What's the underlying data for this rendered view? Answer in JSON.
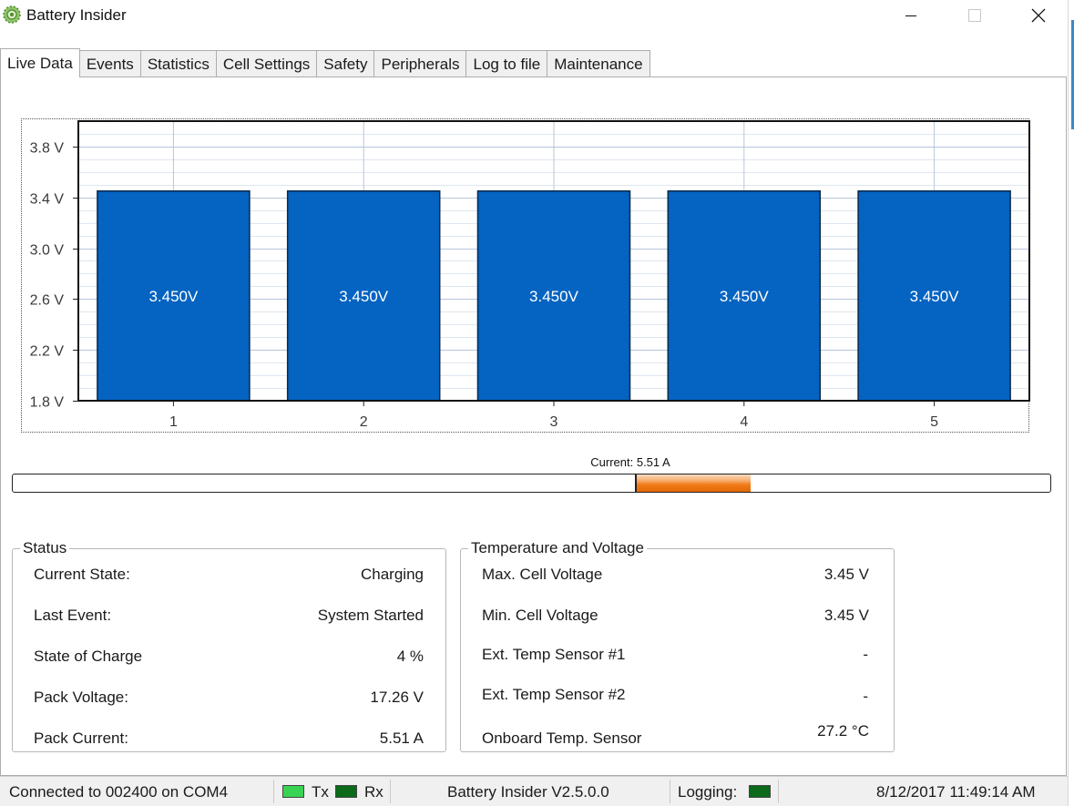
{
  "window": {
    "title": "Battery Insider",
    "icon": "gear-flower-icon",
    "controls": [
      "minimize",
      "maximize",
      "close"
    ]
  },
  "tabs": [
    {
      "label": "Live Data",
      "active": true
    },
    {
      "label": "Events",
      "active": false
    },
    {
      "label": "Statistics",
      "active": false
    },
    {
      "label": "Cell Settings",
      "active": false
    },
    {
      "label": "Safety",
      "active": false
    },
    {
      "label": "Peripherals",
      "active": false
    },
    {
      "label": "Log to file",
      "active": false
    },
    {
      "label": "Maintenance",
      "active": false
    }
  ],
  "chart_data": {
    "type": "bar",
    "categories": [
      "1",
      "2",
      "3",
      "4",
      "5"
    ],
    "values": [
      3.45,
      3.45,
      3.45,
      3.45,
      3.45
    ],
    "bar_labels": [
      "3.450V",
      "3.450V",
      "3.450V",
      "3.450V",
      "3.450V"
    ],
    "ylim": [
      1.8,
      4.0
    ],
    "yticks": [
      1.8,
      2.2,
      2.6,
      3.0,
      3.4,
      3.8
    ],
    "ytick_labels": [
      "1.8 V",
      "2.2 V",
      "2.6 V",
      "3.0 V",
      "3.4 V",
      "3.8 V"
    ],
    "grid": true,
    "bar_color": "#0563c1",
    "title": "",
    "xlabel": "",
    "ylabel": ""
  },
  "current": {
    "label": "Current: 5.51 A",
    "value_a": 5.51,
    "fill_fraction": 0.11,
    "fill_color": "#f07a17"
  },
  "status": {
    "title": "Status",
    "rows": [
      {
        "label": "Current State:",
        "value": "Charging"
      },
      {
        "label": "Last Event:",
        "value": "System Started"
      },
      {
        "label": "State of Charge",
        "value": "4 %"
      },
      {
        "label": "Pack Voltage:",
        "value": "17.26 V"
      },
      {
        "label": "Pack Current:",
        "value": "5.51 A"
      }
    ]
  },
  "temp_voltage": {
    "title": "Temperature and Voltage",
    "rows": [
      {
        "label": "Max. Cell Voltage",
        "value": "3.45 V"
      },
      {
        "label": "Min. Cell Voltage",
        "value": "3.45 V"
      },
      {
        "label": "Ext. Temp Sensor #1",
        "value": "-"
      },
      {
        "label": "Ext. Temp Sensor #2",
        "value": "-"
      },
      {
        "label": "Onboard Temp. Sensor",
        "value": "27.2 °C"
      }
    ]
  },
  "statusbar": {
    "connection": "Connected to 002400 on COM4",
    "tx_label": "Tx",
    "rx_label": "Rx",
    "tx_color": "#39d353",
    "rx_color": "#0b6b1a",
    "version": "Battery Insider V2.5.0.0",
    "logging_label": "Logging:",
    "logging_color": "#0b6b1a",
    "datetime": "8/12/2017 11:49:14 AM"
  }
}
